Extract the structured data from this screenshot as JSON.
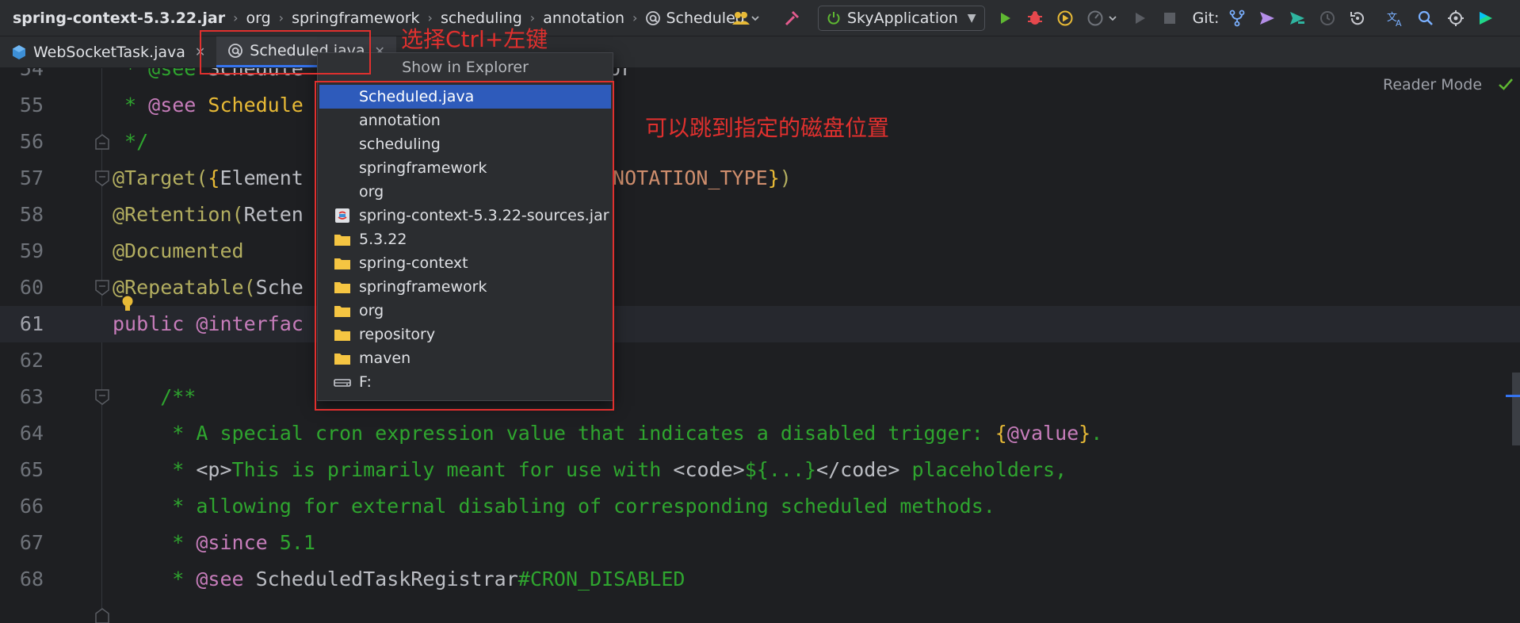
{
  "breadcrumbs": [
    "spring-context-5.3.22.jar",
    "org",
    "springframework",
    "scheduling",
    "annotation",
    "Scheduled"
  ],
  "toolbar": {
    "run_config": "SkyApplication",
    "git_label": "Git:"
  },
  "tabs": [
    {
      "label": "WebSocketTask.java"
    },
    {
      "label": "Scheduled.java"
    }
  ],
  "editor": {
    "reader_mode": "Reader Mode",
    "line_numbers": [
      "54",
      "55",
      "56",
      "57",
      "58",
      "59",
      "60",
      "61",
      "62",
      "63",
      "64",
      "65",
      "66",
      "67",
      "68"
    ],
    "lines": {
      "l54a": " * @see ",
      "l54b": "Schedule",
      "l54c": "essor",
      "l55a": " * @see ",
      "l55b": "Schedule",
      "l56": " */",
      "l57a": "@Target(",
      "l57b": "{",
      "l57c": "Element",
      "l57d": "e.ANNOTATION_TYPE",
      "l57e": "}",
      "l57f": ")",
      "l58a": "@Retention(",
      "l58b": "Reten",
      "l59": "@Documented",
      "l60a": "@Repeatable(",
      "l60b": "Sche",
      "l61a": "public ",
      "l61b": "@interfac",
      "l63": "    /**",
      "l64a": "     * A special cron expression value that indicates a disabled trigger: ",
      "l64b": "{",
      "l64c": "@value",
      "l64d": "}",
      "l64e": ".",
      "l65a": "     * ",
      "l65b": "<p>",
      "l65c": "This is primarily meant for use with ",
      "l65d": "<code>",
      "l65e": "${...}",
      "l65f": "</code>",
      "l65g": " placeholders,",
      "l66": "     * allowing for external disabling of corresponding scheduled methods.",
      "l67a": "     * ",
      "l67b": "@since",
      "l67c": " 5.1",
      "l68a": "     * ",
      "l68b": "@see ",
      "l68c": "ScheduledTaskRegistrar",
      "l68d": "#CRON_DISABLED"
    }
  },
  "popup": {
    "title": "Show in Explorer",
    "items": [
      {
        "label": "Scheduled.java",
        "icon": "none",
        "selected": true
      },
      {
        "label": "annotation",
        "icon": "none"
      },
      {
        "label": "scheduling",
        "icon": "none"
      },
      {
        "label": "springframework",
        "icon": "none"
      },
      {
        "label": "org",
        "icon": "none"
      },
      {
        "label": "spring-context-5.3.22-sources.jar",
        "icon": "jar-icon"
      },
      {
        "label": "5.3.22",
        "icon": "folder-icon"
      },
      {
        "label": "spring-context",
        "icon": "folder-icon"
      },
      {
        "label": "springframework",
        "icon": "folder-icon"
      },
      {
        "label": "org",
        "icon": "folder-icon"
      },
      {
        "label": "repository",
        "icon": "folder-icon"
      },
      {
        "label": "maven",
        "icon": "folder-icon"
      },
      {
        "label": "F:",
        "icon": "drive-icon"
      }
    ]
  },
  "annotations": {
    "hint_ctrl_click": "选择Ctrl+左键",
    "hint_jump_disk": "可以跳到指定的磁盘位置",
    "color": "#e0302e"
  },
  "colors": {
    "accent": "#3574f0",
    "selection": "#2e5bbb",
    "background": "#1e1f22"
  }
}
